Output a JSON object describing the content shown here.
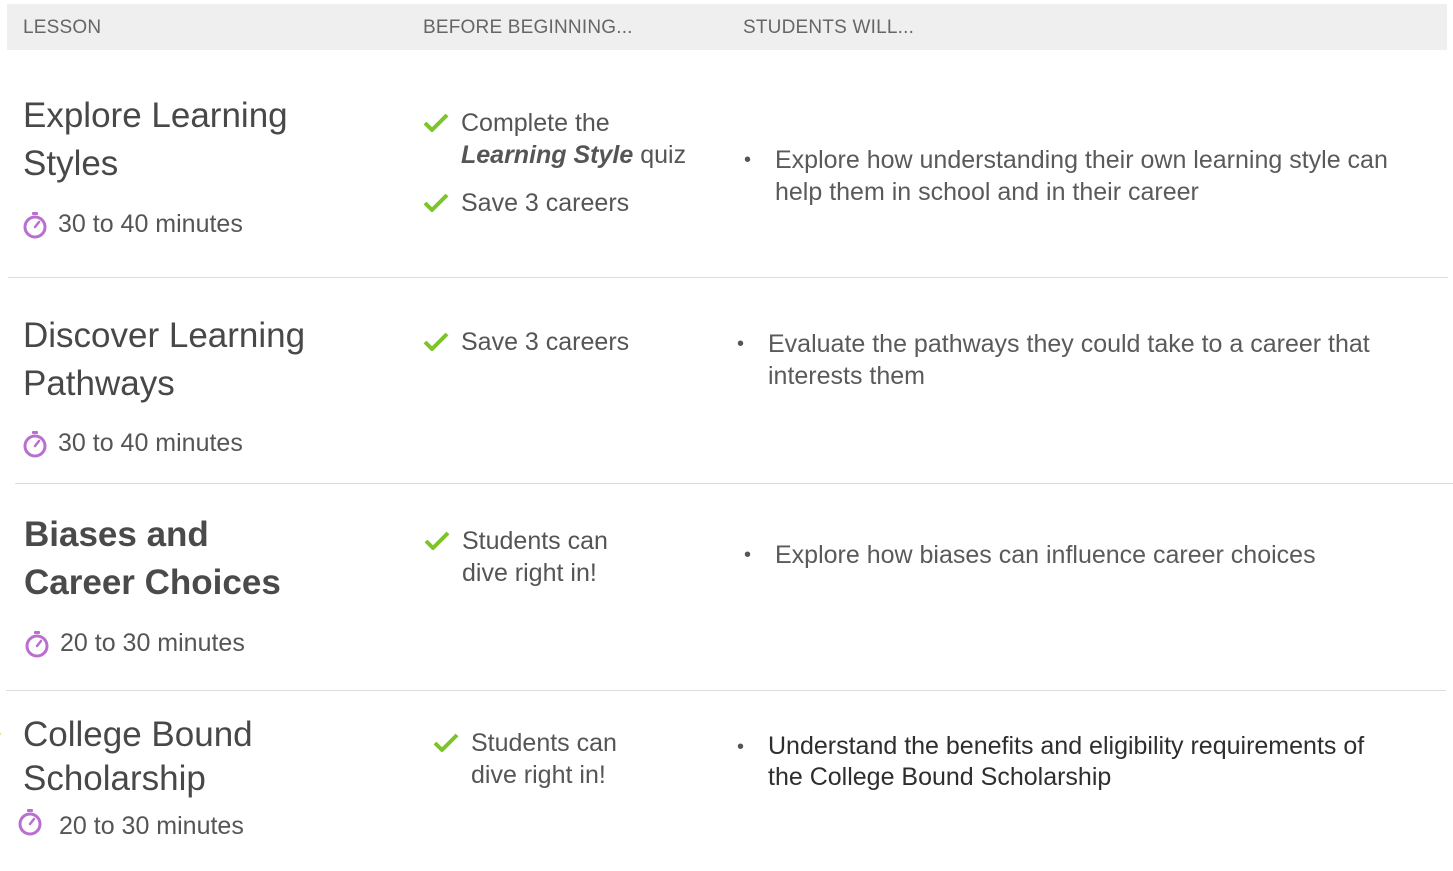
{
  "header": {
    "col_lesson": "LESSON",
    "col_before": "BEFORE BEGINNING...",
    "col_students": "STUDENTS WILL..."
  },
  "colors": {
    "check": "#7cc42a",
    "clock": "#b86fcf",
    "star": "#f5e03a",
    "header_bg": "#efefef"
  },
  "lessons": [
    {
      "title_lines": [
        "Explore Learning",
        "Styles"
      ],
      "duration": "30 to 40 minutes",
      "requirements": [
        {
          "line1_pre": "Complete the",
          "line2_em": "Learning Style",
          "line2_post": " quiz"
        },
        {
          "line1": "Save 3 careers"
        }
      ],
      "objective_lines": [
        "Explore how understanding their own learning style can",
        "help them in school and in their career"
      ]
    },
    {
      "title_lines": [
        "Discover Learning",
        "Pathways"
      ],
      "duration": "30 to 40 minutes",
      "requirements": [
        {
          "line1": "Save 3 careers"
        }
      ],
      "objective_lines": [
        "Evaluate the pathways they could take to a career that",
        "interests them"
      ]
    },
    {
      "title_lines": [
        "Biases and",
        "Career Choices"
      ],
      "duration": "20 to 30 minutes",
      "requirements": [
        {
          "lines": [
            "Students can",
            "dive right in!"
          ]
        }
      ],
      "objective_lines": [
        "Explore how biases can influence career choices"
      ]
    },
    {
      "title_lines": [
        "College Bound",
        "Scholarship"
      ],
      "duration": "20 to 30 minutes",
      "requirements": [
        {
          "lines": [
            "Students can",
            "dive right in!"
          ]
        }
      ],
      "objective_lines": [
        "Understand the benefits and eligibility requirements of",
        "the College Bound Scholarship"
      ]
    }
  ],
  "icons": {
    "check": "check-icon",
    "clock": "stopwatch-icon",
    "star": "star-icon"
  }
}
